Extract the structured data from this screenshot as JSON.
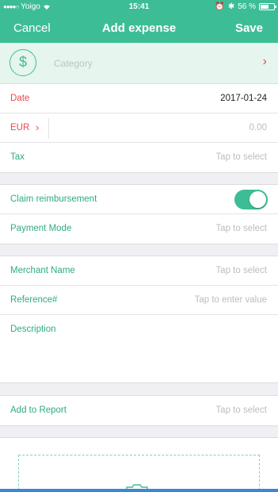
{
  "status": {
    "carrier": "Yoigo",
    "time": "15:41",
    "battery": "56 %"
  },
  "nav": {
    "cancel": "Cancel",
    "title": "Add expense",
    "save": "Save"
  },
  "category": {
    "icon": "dollar-icon",
    "placeholder": "Category"
  },
  "details": {
    "date_label": "Date",
    "date_value": "2017-01-24",
    "currency": "EUR",
    "amount_placeholder": "0.00",
    "tax_label": "Tax",
    "tax_value": "Tap to select"
  },
  "reimbursement": {
    "claim_label": "Claim reimbursement",
    "claim_on": true,
    "payment_label": "Payment Mode",
    "payment_value": "Tap to select"
  },
  "merchant": {
    "merchant_label": "Merchant Name",
    "merchant_value": "Tap to select",
    "reference_label": "Reference#",
    "reference_value": "Tap to enter value",
    "description_label": "Description"
  },
  "report": {
    "label": "Add to Report",
    "value": "Tap to select"
  },
  "colors": {
    "accent": "#3dbd96",
    "danger": "#e8474a"
  }
}
